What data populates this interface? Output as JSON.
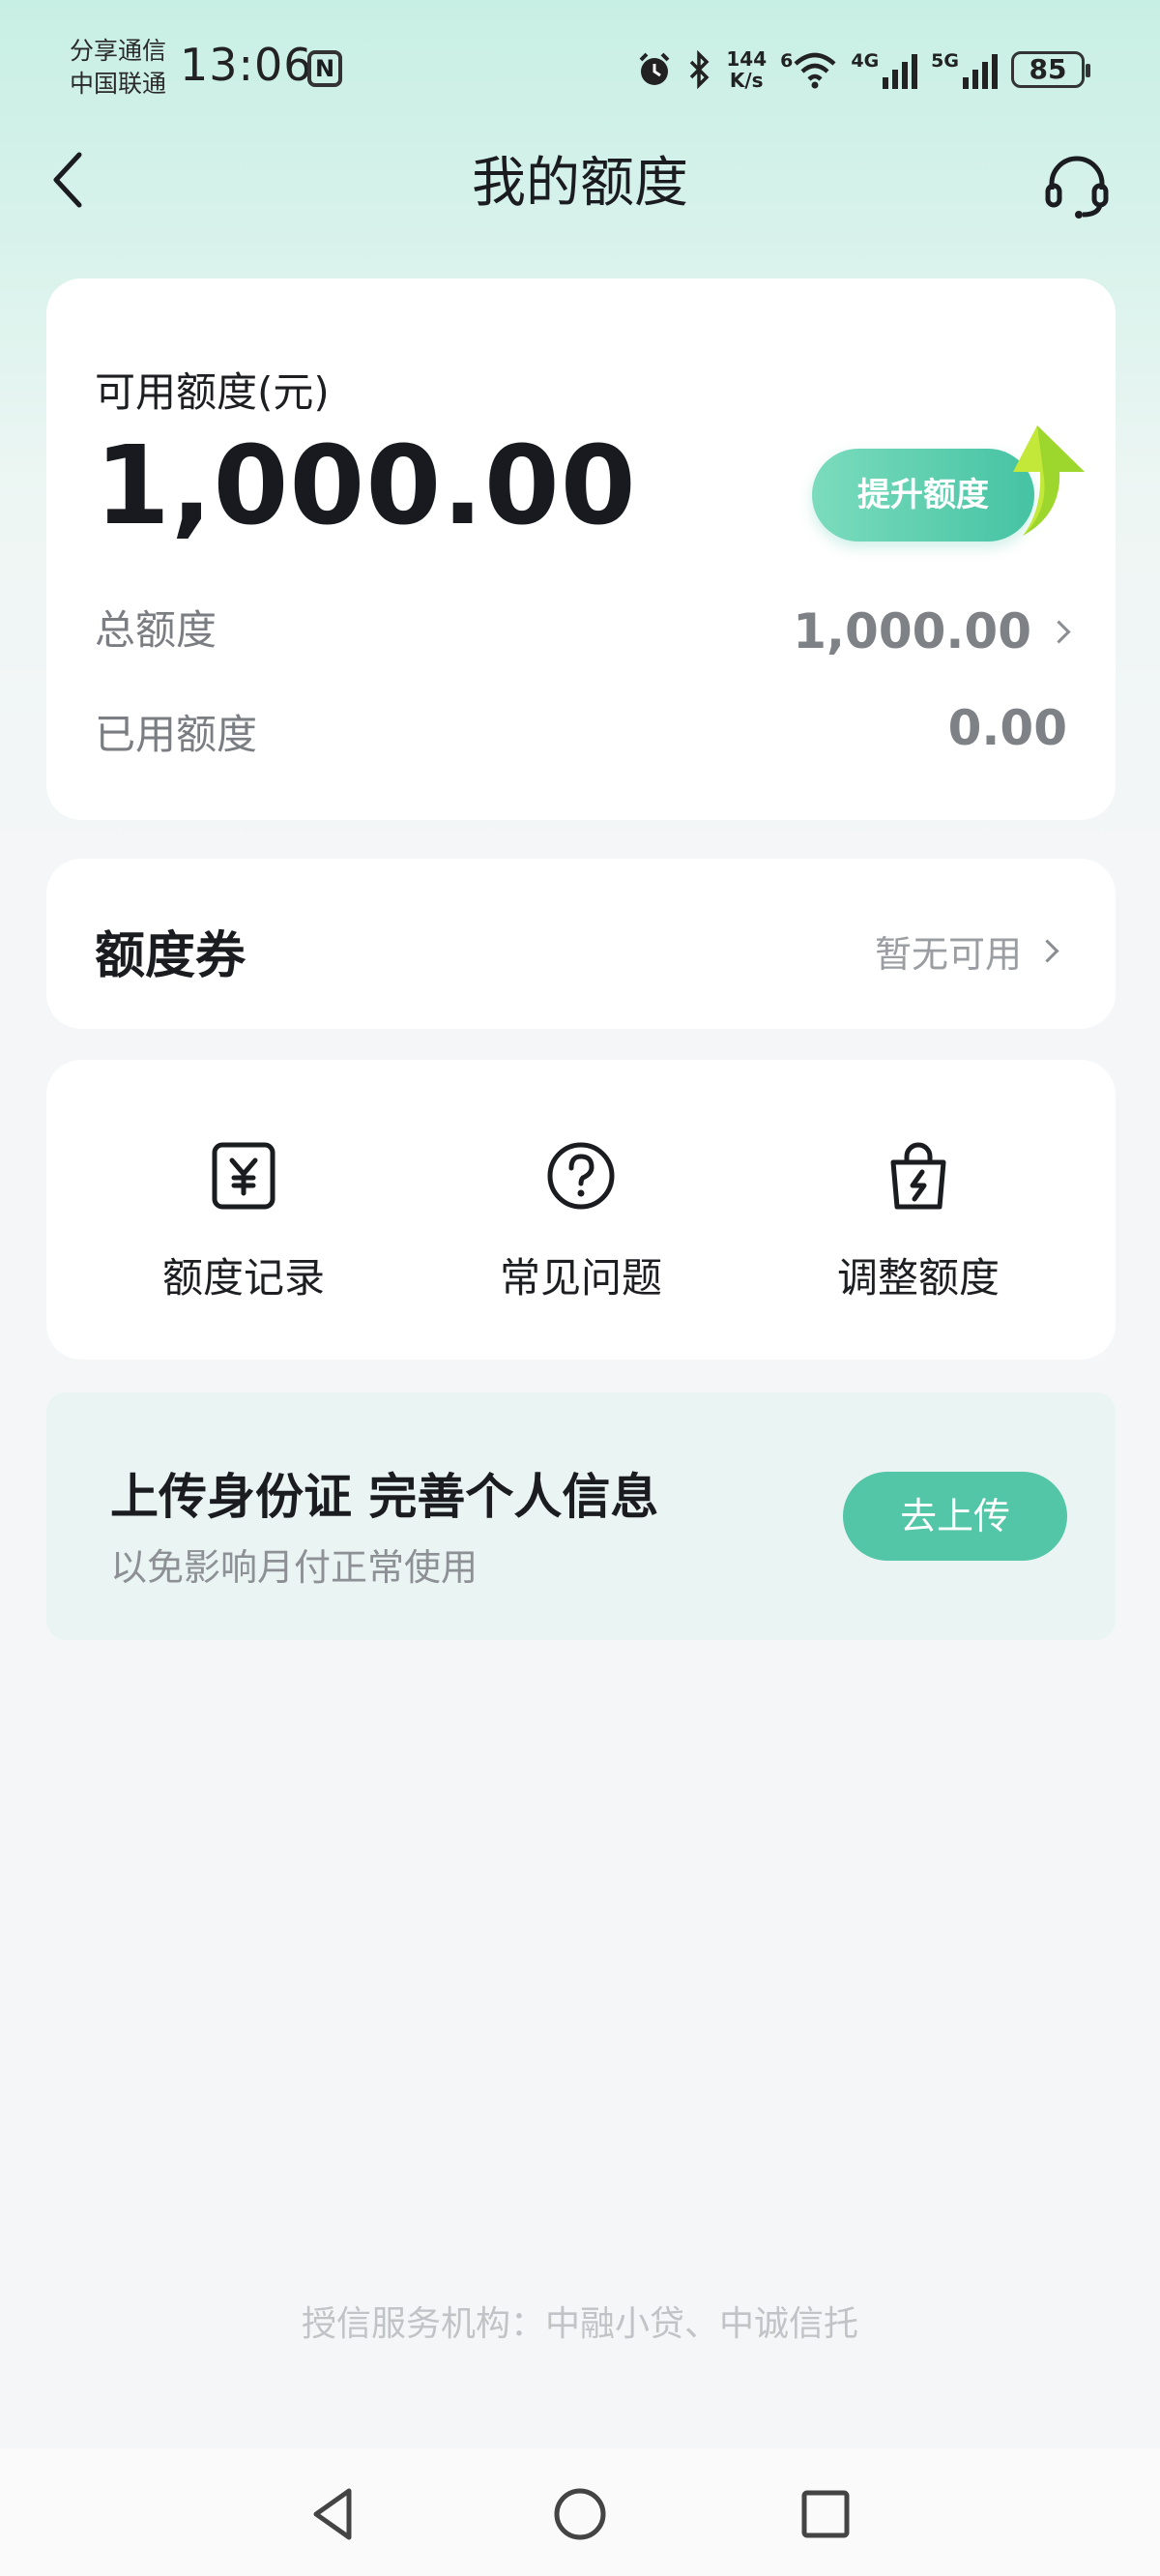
{
  "status_bar": {
    "carrier_line1": "分享通信",
    "carrier_line2": "中国联通",
    "time": "13:06",
    "nfc_icon": "N",
    "speed_value": "144",
    "speed_unit": "K/s",
    "wifi_badge": "6",
    "signal1_label": "4G",
    "signal2_label": "5G",
    "battery": "85"
  },
  "header": {
    "title": "我的额度"
  },
  "quota": {
    "available_label": "可用额度(元)",
    "available_value": "1,000.00",
    "raise_button": "提升额度",
    "total_label": "总额度",
    "total_value": "1,000.00",
    "used_label": "已用额度",
    "used_value": "0.00"
  },
  "coupon": {
    "title": "额度券",
    "status": "暂无可用"
  },
  "actions": [
    {
      "label": "额度记录",
      "icon": "yuan-receipt-icon"
    },
    {
      "label": "常见问题",
      "icon": "question-circle-icon"
    },
    {
      "label": "调整额度",
      "icon": "lightning-bag-icon"
    }
  ],
  "upload": {
    "title": "上传身份证 完善个人信息",
    "subtitle": "以免影响月付正常使用",
    "button": "去上传"
  },
  "footer": {
    "note": "授信服务机构：中融小贷、中诚信托"
  },
  "colors": {
    "accent": "#52c6a6",
    "header_bg": "#c8efe4",
    "page_bg": "#f4f6f7",
    "upload_bg": "#eaf5f3"
  }
}
